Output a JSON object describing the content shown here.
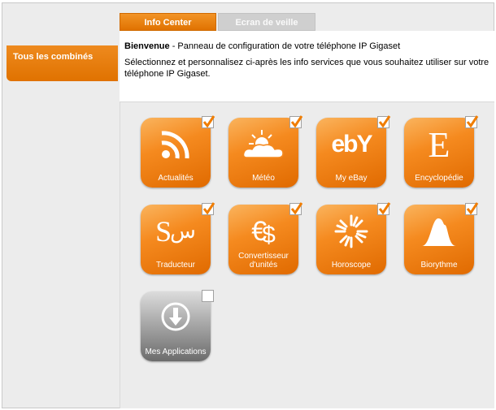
{
  "sidebar": {
    "items": [
      {
        "label": "Tous les combinés"
      }
    ]
  },
  "tabs": [
    {
      "label": "Info Center",
      "active": true
    },
    {
      "label": "Ecran de veille",
      "active": false
    }
  ],
  "header": {
    "welcome_title": "Bienvenue",
    "welcome_text": " - Panneau de configuration de votre téléphone IP Gigaset",
    "instruction": "Sélectionnez et personnalisez ci-après les info services que vous souhaitez utiliser sur votre téléphone IP Gigaset."
  },
  "tiles": [
    {
      "label": "Actualités",
      "icon": "rss-icon",
      "checked": true
    },
    {
      "label": "Météo",
      "icon": "weather-icon",
      "checked": true
    },
    {
      "label": "My eBay",
      "icon": "ebay-logo",
      "checked": true,
      "logo_text": "ebY"
    },
    {
      "label": "Encyclopédie",
      "icon": "encyclopedia-icon",
      "checked": true,
      "glyph": "E"
    },
    {
      "label": "Traducteur",
      "icon": "translator-icon",
      "checked": true,
      "glyph_a": "S",
      "glyph_b": "س"
    },
    {
      "label": "Convertisseur d'unités",
      "icon": "currency-icon",
      "checked": true,
      "glyph_a": "€",
      "glyph_b": "$"
    },
    {
      "label": "Horoscope",
      "icon": "horoscope-icon",
      "checked": true
    },
    {
      "label": "Biorythme",
      "icon": "biorhythm-icon",
      "checked": true
    },
    {
      "label": "Mes Applications",
      "icon": "download-icon",
      "checked": false
    }
  ],
  "colors": {
    "accent": "#f07d00",
    "check": "#f07d00",
    "inactive_tab": "#cfcfcf"
  }
}
